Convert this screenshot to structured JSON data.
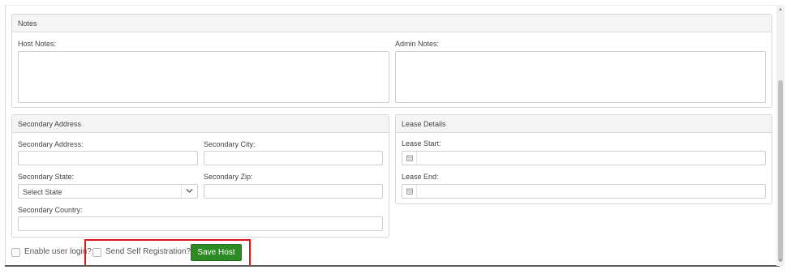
{
  "notes": {
    "title": "Notes",
    "host_notes_label": "Host Notes:",
    "admin_notes_label": "Admin Notes:",
    "host_notes_value": "",
    "admin_notes_value": ""
  },
  "secondary_address": {
    "title": "Secondary Address",
    "address_label": "Secondary Address:",
    "city_label": "Secondary City:",
    "state_label": "Secondary State:",
    "state_value": "Select State",
    "zip_label": "Secondary Zip:",
    "country_label": "Secondary Country:"
  },
  "lease_details": {
    "title": "Lease Details",
    "start_label": "Lease Start:",
    "end_label": "Lease End:"
  },
  "footer": {
    "enable_login_label": "Enable user login?:",
    "self_registration_label": "Send Self Registration?:",
    "save_label": "Save Host"
  },
  "icons": {
    "calendar": "calendar-icon",
    "chevron": "chevron-down-icon"
  },
  "colors": {
    "save_button": "#2e8b23",
    "highlight_border": "#e01515"
  }
}
